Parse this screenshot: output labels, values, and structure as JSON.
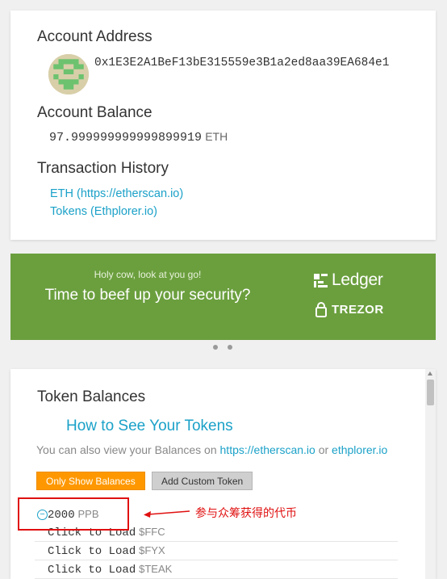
{
  "account": {
    "address_heading": "Account Address",
    "address": "0x1E3E2A1BeF13bE315559e3B1a2ed8aa39EA684e1",
    "balance_heading": "Account Balance",
    "balance_value": "97.999999999999899919",
    "balance_unit": "ETH",
    "history_heading": "Transaction History",
    "history_links": [
      "ETH (https://etherscan.io)",
      "Tokens (Ethplorer.io)"
    ]
  },
  "promo": {
    "small_text": "Holy cow, look at you go!",
    "title": "Time to beef up your security?",
    "brand_1": "Ledger",
    "brand_2": "TREZOR",
    "slide_count": 2
  },
  "tokens": {
    "heading": "Token Balances",
    "how_to_link": "How to See Your Tokens",
    "also_text": "You can also view your Balances on",
    "link_etherscan": "https://etherscan.io",
    "or_text": "or",
    "link_ethplorer": "ethplorer.io",
    "btn_only_balances": "Only Show Balances",
    "btn_add_custom": "Add Custom Token",
    "rows": [
      {
        "amount": "2000",
        "symbol": "PPB"
      },
      {
        "amount": "Click to Load",
        "symbol": "$FFC"
      },
      {
        "amount": "Click to Load",
        "symbol": "$FYX"
      },
      {
        "amount": "Click to Load",
        "symbol": "$TEAK"
      }
    ]
  },
  "annotation": {
    "text": "参与众筹获得的代币",
    "color": "#e01010"
  },
  "colors": {
    "accent": "#1ba1c8",
    "promo_bg": "#6b9f3e",
    "orange": "#ff9800"
  }
}
